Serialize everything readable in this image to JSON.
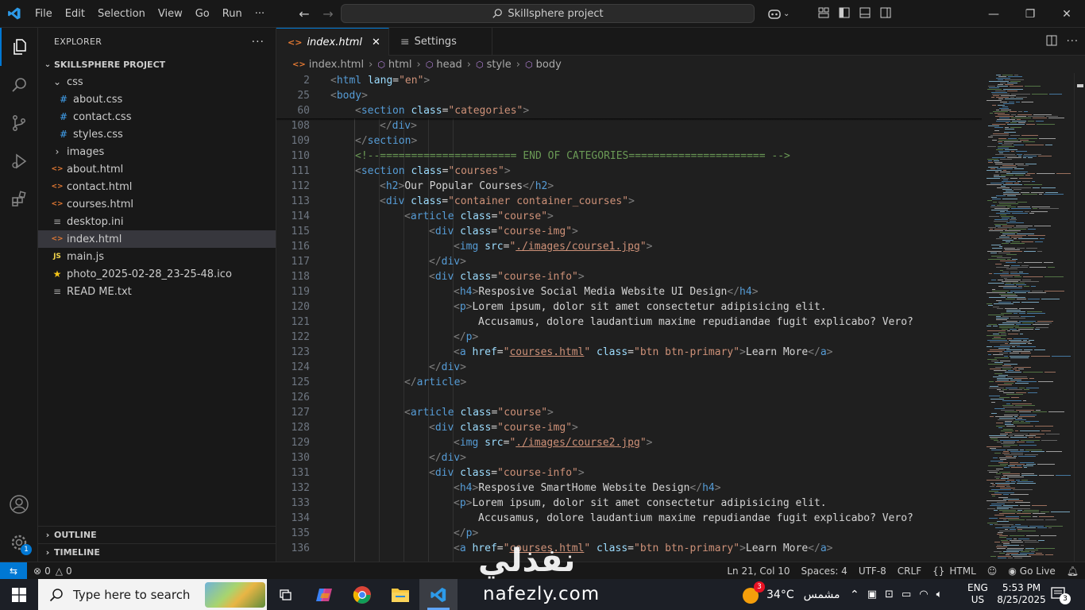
{
  "titlebar": {
    "menu": [
      "File",
      "Edit",
      "Selection",
      "View",
      "Go",
      "Run",
      "···"
    ],
    "search": "Skillsphere project"
  },
  "explorer": {
    "header": "EXPLORER",
    "project": "SKILLSPHERE PROJECT",
    "tree": [
      {
        "label": "css",
        "kind": "folder-open",
        "indent": 1
      },
      {
        "label": "about.css",
        "kind": "css",
        "indent": 2
      },
      {
        "label": "contact.css",
        "kind": "css",
        "indent": 2
      },
      {
        "label": "styles.css",
        "kind": "css",
        "indent": 2
      },
      {
        "label": "images",
        "kind": "folder",
        "indent": 1
      },
      {
        "label": "about.html",
        "kind": "html",
        "indent": 1
      },
      {
        "label": "contact.html",
        "kind": "html",
        "indent": 1
      },
      {
        "label": "courses.html",
        "kind": "html",
        "indent": 1
      },
      {
        "label": "desktop.ini",
        "kind": "text",
        "indent": 1
      },
      {
        "label": "index.html",
        "kind": "html",
        "indent": 1,
        "selected": true
      },
      {
        "label": "main.js",
        "kind": "js",
        "indent": 1
      },
      {
        "label": "photo_2025-02-28_23-25-48.ico",
        "kind": "star",
        "indent": 1
      },
      {
        "label": "READ ME.txt",
        "kind": "text",
        "indent": 1
      }
    ],
    "outline": "OUTLINE",
    "timeline": "TIMELINE"
  },
  "tabs": [
    {
      "label": "index.html",
      "active": true
    },
    {
      "label": "Settings",
      "active": false
    }
  ],
  "breadcrumb": [
    "index.html",
    "html",
    "head",
    "style",
    "body"
  ],
  "code": {
    "sticky": [
      {
        "n": "2",
        "indent": 0,
        "html": "<span class=\"t\">&lt;</span><span class=\"tn\">html</span> <span class=\"an\">lang</span><span class=\"tx\">=</span><span class=\"av\">\"en\"</span><span class=\"t\">&gt;</span>"
      },
      {
        "n": "25",
        "indent": 0,
        "html": "<span class=\"t\">&lt;</span><span class=\"tn\">body</span><span class=\"t\">&gt;</span>"
      },
      {
        "n": "60",
        "indent": 1,
        "html": "<span class=\"t\">&lt;</span><span class=\"tn\">section</span> <span class=\"an\">class</span><span class=\"tx\">=</span><span class=\"av\">\"categories\"</span><span class=\"t\">&gt;</span>"
      }
    ],
    "lines": [
      {
        "n": "108",
        "indent": 2,
        "html": "<span class=\"t\">&lt;/</span><span class=\"tn\">div</span><span class=\"t\">&gt;</span>"
      },
      {
        "n": "109",
        "indent": 1,
        "html": "<span class=\"t\">&lt;/</span><span class=\"tn\">section</span><span class=\"t\">&gt;</span>"
      },
      {
        "n": "110",
        "indent": 1,
        "html": "<span class=\"cm\">&lt;!--====================== END OF CATEGORIES====================== --&gt;</span>"
      },
      {
        "n": "111",
        "indent": 1,
        "html": "<span class=\"t\">&lt;</span><span class=\"tn\">section</span> <span class=\"an\">class</span><span class=\"tx\">=</span><span class=\"av\">\"courses\"</span><span class=\"t\">&gt;</span>"
      },
      {
        "n": "112",
        "indent": 2,
        "html": "<span class=\"t\">&lt;</span><span class=\"tn\">h2</span><span class=\"t\">&gt;</span><span class=\"tx\">Our Popular Courses</span><span class=\"t\">&lt;/</span><span class=\"tn\">h2</span><span class=\"t\">&gt;</span>"
      },
      {
        "n": "113",
        "indent": 2,
        "html": "<span class=\"t\">&lt;</span><span class=\"tn\">div</span> <span class=\"an\">class</span><span class=\"tx\">=</span><span class=\"av\">\"container container_courses\"</span><span class=\"t\">&gt;</span>"
      },
      {
        "n": "114",
        "indent": 3,
        "html": "<span class=\"t\">&lt;</span><span class=\"tn\">article</span> <span class=\"an\">class</span><span class=\"tx\">=</span><span class=\"av\">\"course\"</span><span class=\"t\">&gt;</span>"
      },
      {
        "n": "115",
        "indent": 4,
        "html": "<span class=\"t\">&lt;</span><span class=\"tn\">div</span> <span class=\"an\">class</span><span class=\"tx\">=</span><span class=\"av\">\"course-img\"</span><span class=\"t\">&gt;</span>"
      },
      {
        "n": "116",
        "indent": 5,
        "html": "<span class=\"t\">&lt;</span><span class=\"tn\">img</span> <span class=\"an\">src</span><span class=\"tx\">=</span><span class=\"av\">\"<span class=\"lnk\">./images/course1.jpg</span>\"</span><span class=\"t\">&gt;</span>"
      },
      {
        "n": "117",
        "indent": 4,
        "html": "<span class=\"t\">&lt;/</span><span class=\"tn\">div</span><span class=\"t\">&gt;</span>"
      },
      {
        "n": "118",
        "indent": 4,
        "html": "<span class=\"t\">&lt;</span><span class=\"tn\">div</span> <span class=\"an\">class</span><span class=\"tx\">=</span><span class=\"av\">\"course-info\"</span><span class=\"t\">&gt;</span>"
      },
      {
        "n": "119",
        "indent": 5,
        "html": "<span class=\"t\">&lt;</span><span class=\"tn\">h4</span><span class=\"t\">&gt;</span><span class=\"tx\">Resposive Social Media Website UI Design</span><span class=\"t\">&lt;/</span><span class=\"tn\">h4</span><span class=\"t\">&gt;</span>"
      },
      {
        "n": "120",
        "indent": 5,
        "html": "<span class=\"t\">&lt;</span><span class=\"tn\">p</span><span class=\"t\">&gt;</span><span class=\"tx\">Lorem ipsum, dolor sit amet consectetur adipisicing elit.</span>"
      },
      {
        "n": "121",
        "indent": 6,
        "html": "<span class=\"tx\">Accusamus, dolore laudantium maxime repudiandae fugit explicabo? Vero?</span>"
      },
      {
        "n": "122",
        "indent": 5,
        "html": "<span class=\"t\">&lt;/</span><span class=\"tn\">p</span><span class=\"t\">&gt;</span>"
      },
      {
        "n": "123",
        "indent": 5,
        "html": "<span class=\"t\">&lt;</span><span class=\"tn\">a</span> <span class=\"an\">href</span><span class=\"tx\">=</span><span class=\"av\">\"<span class=\"lnk\">courses.html</span>\"</span> <span class=\"an\">class</span><span class=\"tx\">=</span><span class=\"av\">\"btn btn-primary\"</span><span class=\"t\">&gt;</span><span class=\"tx\">Learn More</span><span class=\"t\">&lt;/</span><span class=\"tn\">a</span><span class=\"t\">&gt;</span>"
      },
      {
        "n": "124",
        "indent": 4,
        "html": "<span class=\"t\">&lt;/</span><span class=\"tn\">div</span><span class=\"t\">&gt;</span>"
      },
      {
        "n": "125",
        "indent": 3,
        "html": "<span class=\"t\">&lt;/</span><span class=\"tn\">article</span><span class=\"t\">&gt;</span>"
      },
      {
        "n": "126",
        "indent": 0,
        "html": ""
      },
      {
        "n": "127",
        "indent": 3,
        "html": "<span class=\"t\">&lt;</span><span class=\"tn\">article</span> <span class=\"an\">class</span><span class=\"tx\">=</span><span class=\"av\">\"course\"</span><span class=\"t\">&gt;</span>"
      },
      {
        "n": "128",
        "indent": 4,
        "html": "<span class=\"t\">&lt;</span><span class=\"tn\">div</span> <span class=\"an\">class</span><span class=\"tx\">=</span><span class=\"av\">\"course-img\"</span><span class=\"t\">&gt;</span>"
      },
      {
        "n": "129",
        "indent": 5,
        "html": "<span class=\"t\">&lt;</span><span class=\"tn\">img</span> <span class=\"an\">src</span><span class=\"tx\">=</span><span class=\"av\">\"<span class=\"lnk\">./images/course2.jpg</span>\"</span><span class=\"t\">&gt;</span>"
      },
      {
        "n": "130",
        "indent": 4,
        "html": "<span class=\"t\">&lt;/</span><span class=\"tn\">div</span><span class=\"t\">&gt;</span>"
      },
      {
        "n": "131",
        "indent": 4,
        "html": "<span class=\"t\">&lt;</span><span class=\"tn\">div</span> <span class=\"an\">class</span><span class=\"tx\">=</span><span class=\"av\">\"course-info\"</span><span class=\"t\">&gt;</span>"
      },
      {
        "n": "132",
        "indent": 5,
        "html": "<span class=\"t\">&lt;</span><span class=\"tn\">h4</span><span class=\"t\">&gt;</span><span class=\"tx\">Resposive SmartHome Website Design</span><span class=\"t\">&lt;/</span><span class=\"tn\">h4</span><span class=\"t\">&gt;</span>"
      },
      {
        "n": "133",
        "indent": 5,
        "html": "<span class=\"t\">&lt;</span><span class=\"tn\">p</span><span class=\"t\">&gt;</span><span class=\"tx\">Lorem ipsum, dolor sit amet consectetur adipisicing elit.</span>"
      },
      {
        "n": "134",
        "indent": 6,
        "html": "<span class=\"tx\">Accusamus, dolore laudantium maxime repudiandae fugit explicabo? Vero?</span>"
      },
      {
        "n": "135",
        "indent": 5,
        "html": "<span class=\"t\">&lt;/</span><span class=\"tn\">p</span><span class=\"t\">&gt;</span>"
      },
      {
        "n": "136",
        "indent": 5,
        "html": "<span class=\"t\">&lt;</span><span class=\"tn\">a</span> <span class=\"an\">href</span><span class=\"tx\">=</span><span class=\"av\">\"<span class=\"lnk\">courses.html</span>\"</span> <span class=\"an\">class</span><span class=\"tx\">=</span><span class=\"av\">\"btn btn-primary\"</span><span class=\"t\">&gt;</span><span class=\"tx\">Learn More</span><span class=\"t\">&lt;/</span><span class=\"tn\">a</span><span class=\"t\">&gt;</span>"
      }
    ]
  },
  "status": {
    "problems_errors": "0",
    "problems_warnings": "0",
    "position": "Ln 21, Col 10",
    "spaces": "Spaces: 4",
    "encoding": "UTF-8",
    "eol": "CRLF",
    "language": "HTML",
    "golive": "Go Live"
  },
  "taskbar": {
    "search_placeholder": "Type here to search",
    "temperature": "34°C",
    "weather_text": "مشمس",
    "weather_badge": "3",
    "lang_line1": "ENG",
    "lang_line2": "US",
    "time": "5:53 PM",
    "date": "8/25/2025",
    "notif_count": "3"
  },
  "watermark": {
    "arabic": "نفذلي",
    "latin": "nafezly.com"
  },
  "colors": {
    "accent": "#0078d4",
    "editor_bg": "#1f1f1f",
    "sidebar_bg": "#181818"
  }
}
